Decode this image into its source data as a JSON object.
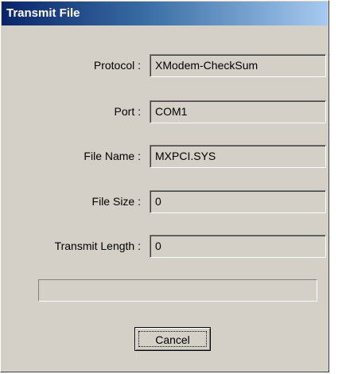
{
  "window": {
    "title": "Transmit File"
  },
  "fields": [
    {
      "label": "Protocol :",
      "value": "XModem-CheckSum"
    },
    {
      "label": "Port :",
      "value": "COM1"
    },
    {
      "label": "File Name :",
      "value": "MXPCI.SYS"
    },
    {
      "label": "File Size :",
      "value": "0"
    },
    {
      "label": "Transmit Length :",
      "value": "0"
    }
  ],
  "progress": {
    "fraction": 0
  },
  "buttons": {
    "cancel_label": "Cancel"
  },
  "colors": {
    "title_gradient_start": "#0a246a",
    "title_gradient_end": "#a6caf0",
    "dialog_face": "#d4d0c8"
  }
}
